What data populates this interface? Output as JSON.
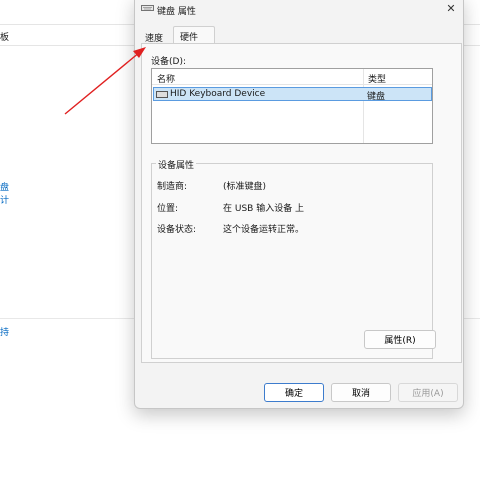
{
  "background": {
    "top_bar_text": "板",
    "links": [
      {
        "id": "link-1",
        "text": "盘"
      },
      {
        "id": "link-2",
        "text": "计"
      },
      {
        "id": "link-3",
        "text": "持"
      }
    ]
  },
  "dialog": {
    "title": "键盘 属性",
    "close_glyph": "✕",
    "tabs": [
      {
        "label": "速度",
        "active": false
      },
      {
        "label": "硬件",
        "active": true
      }
    ],
    "devices_label": "设备(D):",
    "device_list": {
      "columns": [
        "名称",
        "类型"
      ],
      "rows": [
        {
          "name": "HID Keyboard Device",
          "type": "键盘",
          "selected": true
        }
      ]
    },
    "properties": {
      "legend": "设备属性",
      "items": [
        {
          "label": "制造商:",
          "value": "(标准键盘)"
        },
        {
          "label": "位置:",
          "value": "在 USB 输入设备 上"
        },
        {
          "label": "设备状态:",
          "value": "这个设备运转正常。"
        }
      ],
      "properties_button": "属性(R)"
    },
    "buttons": {
      "ok": "确定",
      "cancel": "取消",
      "apply": "应用(A)"
    }
  },
  "colors": {
    "accent": "#3d7ccd",
    "link": "#0067c0",
    "selection": "#cce4f7",
    "annotation_arrow": "#e02020"
  },
  "icons": {
    "title": "keyboard-icon",
    "device": "keyboard-icon",
    "close": "close-icon"
  }
}
